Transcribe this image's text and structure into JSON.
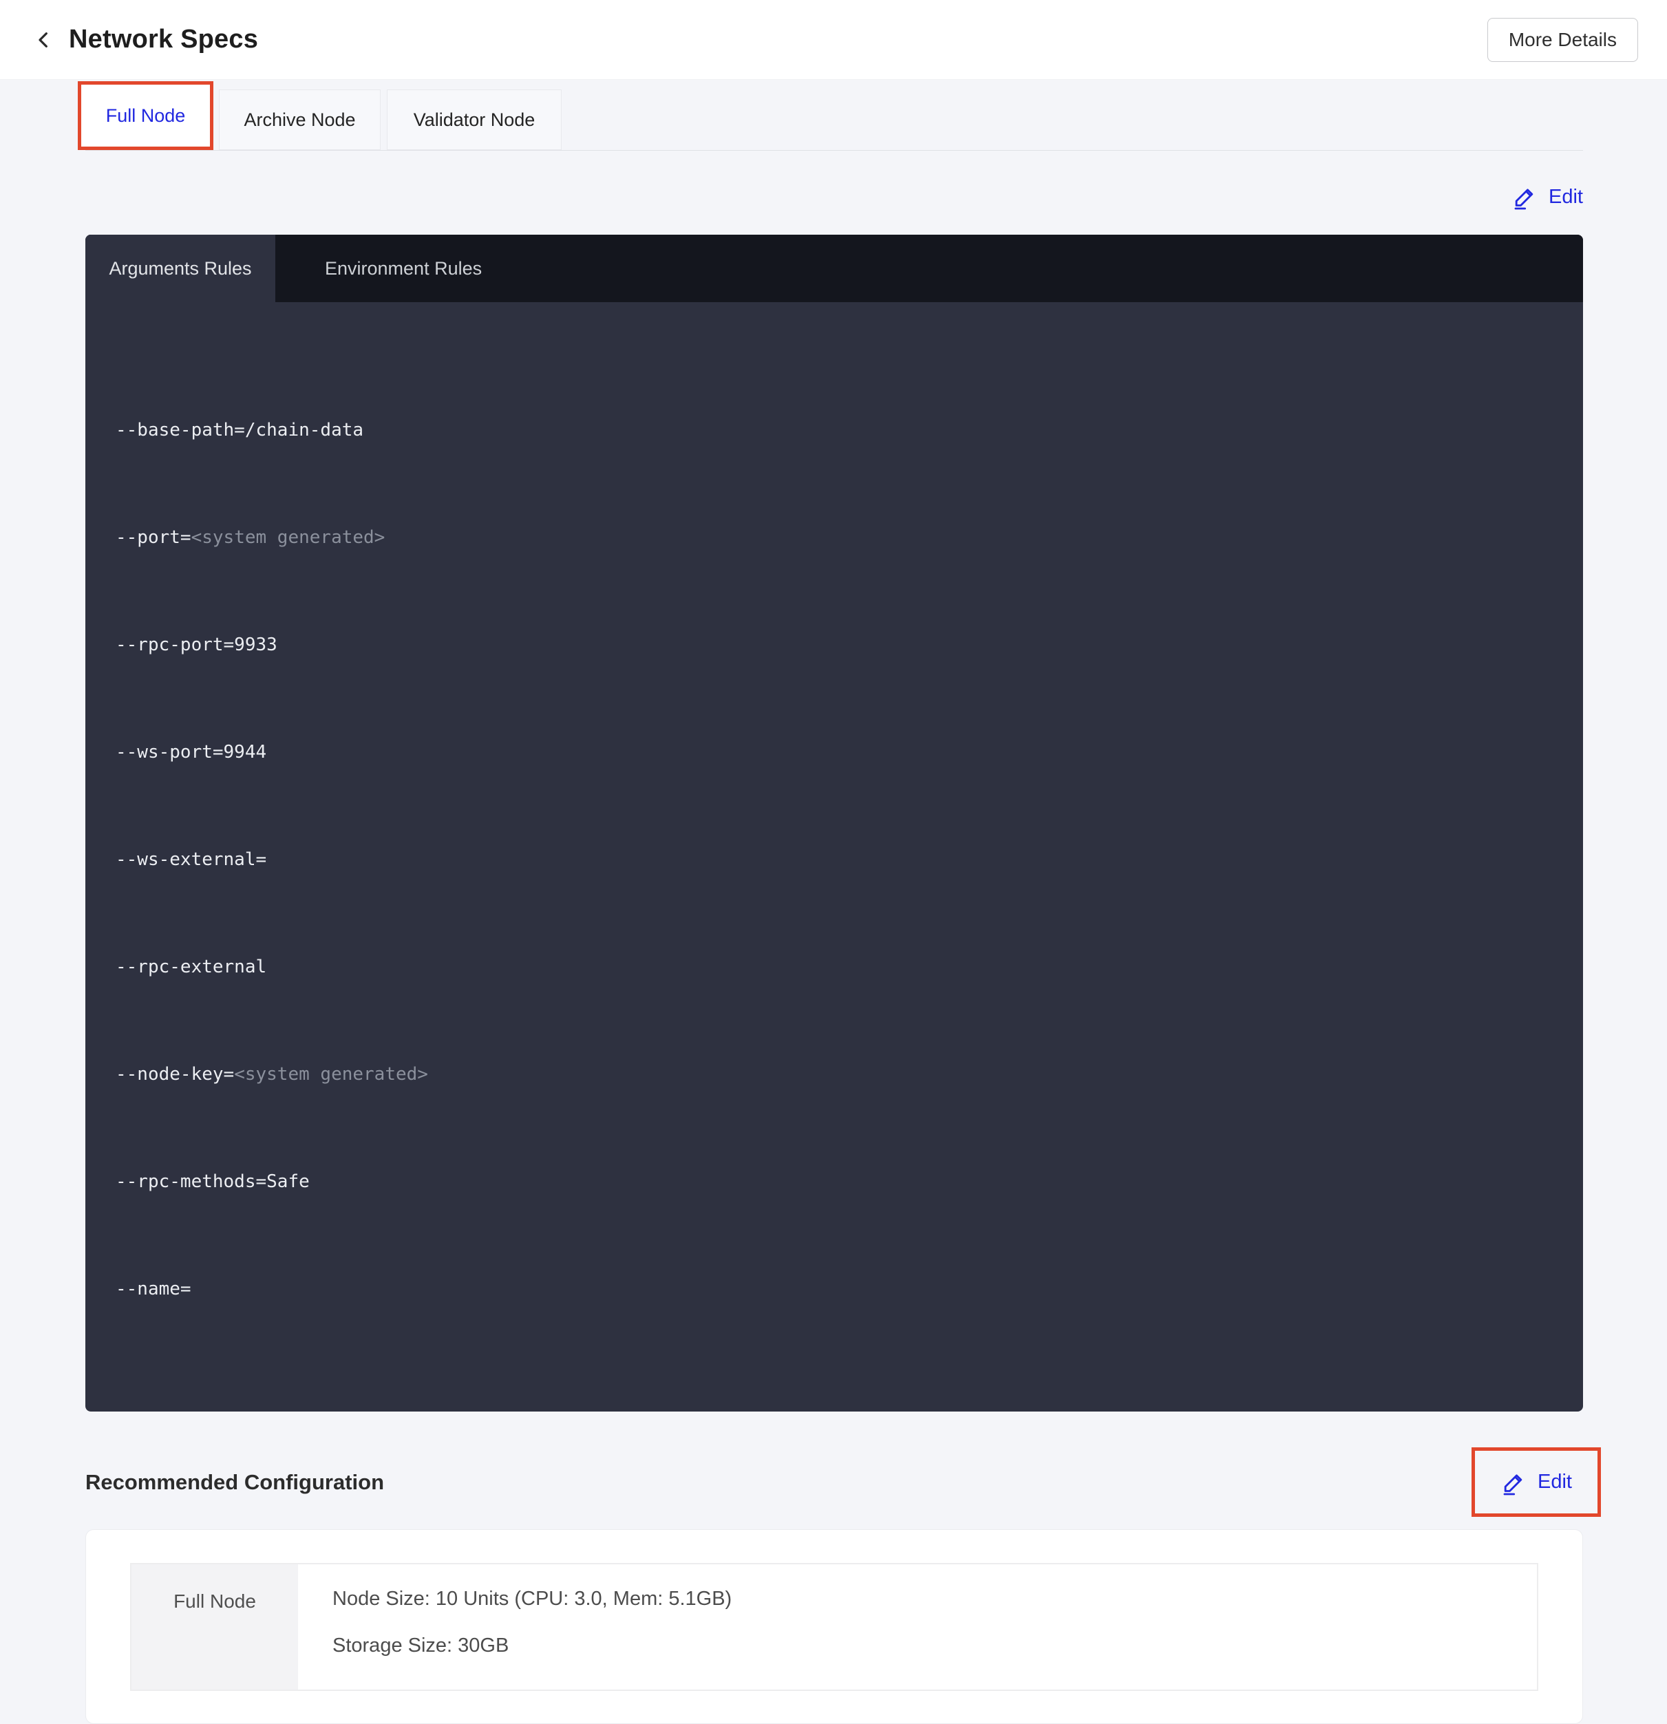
{
  "colors": {
    "accent_blue": "#2128e0",
    "annotation_red": "#e2472c",
    "panel_body_bg": "#2e3140",
    "panel_tab_bar_bg": "#14161e",
    "page_bg": "#f4f5f9"
  },
  "header": {
    "title": "Network Specs",
    "more_details_label": "More Details"
  },
  "node_tabs": [
    {
      "label": "Full Node",
      "active": true
    },
    {
      "label": "Archive Node",
      "active": false
    },
    {
      "label": "Validator Node",
      "active": false
    }
  ],
  "rules_section": {
    "edit_label": "Edit",
    "tabs": [
      {
        "label": "Arguments Rules",
        "active": true
      },
      {
        "label": "Environment Rules",
        "active": false
      }
    ],
    "argument_lines": [
      {
        "text": "--base-path=/chain-data"
      },
      {
        "text": "--port=",
        "dim": "<system generated>"
      },
      {
        "text": "--rpc-port=9933"
      },
      {
        "text": "--ws-port=9944"
      },
      {
        "text": "--ws-external="
      },
      {
        "text": "--rpc-external"
      },
      {
        "text": "--node-key=",
        "dim": "<system generated>"
      },
      {
        "text": "--rpc-methods=Safe"
      },
      {
        "text": "--name="
      }
    ]
  },
  "recommended_section": {
    "title": "Recommended Configuration",
    "edit_label": "Edit",
    "config_row": {
      "label": "Full Node",
      "node_size_line": "Node Size: 10 Units (CPU: 3.0, Mem: 5.1GB)",
      "storage_size_line": "Storage Size: 30GB"
    }
  }
}
